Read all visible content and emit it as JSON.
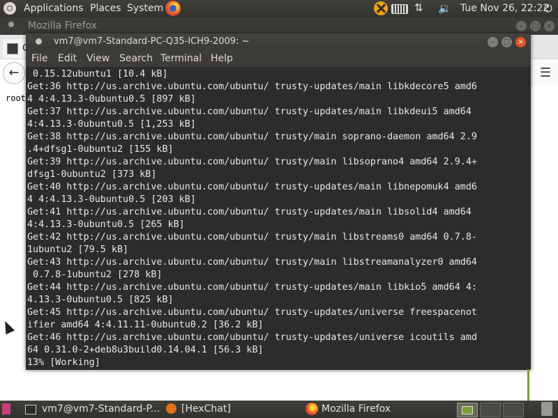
{
  "top_panel": {
    "menus": [
      "Applications",
      "Places",
      "System"
    ],
    "clock": "Tue Nov 26, 22:22",
    "icons": [
      "ubuntu-logo",
      "firefox-launcher-icon",
      "indicator-x-icon",
      "keyboard-icon",
      "network-icon",
      "volume-icon",
      "power-icon"
    ]
  },
  "firefox": {
    "window_title": "Mozilla Firefox",
    "tab_label": "C",
    "page_text": "root"
  },
  "terminal": {
    "window_title": "vm7@vm7-Standard-PC-Q35-ICH9-2009: ~",
    "menu": [
      "File",
      "Edit",
      "View",
      "Search",
      "Terminal",
      "Help"
    ],
    "lines": [
      " 0.15.12ubuntu1 [10.4 kB]",
      "Get:36 http://us.archive.ubuntu.com/ubuntu/ trusty-updates/main libkdecore5 amd6",
      "4 4:4.13.3-0ubuntu0.5 [897 kB]",
      "Get:37 http://us.archive.ubuntu.com/ubuntu/ trusty-updates/main libkdeui5 amd64",
      "4:4.13.3-0ubuntu0.5 [1,253 kB]",
      "Get:38 http://us.archive.ubuntu.com/ubuntu/ trusty/main soprano-daemon amd64 2.9",
      ".4+dfsg1-0ubuntu2 [155 kB]",
      "Get:39 http://us.archive.ubuntu.com/ubuntu/ trusty/main libsoprano4 amd64 2.9.4+",
      "dfsg1-0ubuntu2 [373 kB]",
      "Get:40 http://us.archive.ubuntu.com/ubuntu/ trusty-updates/main libnepomuk4 amd6",
      "4 4:4.13.3-0ubuntu0.5 [203 kB]",
      "Get:41 http://us.archive.ubuntu.com/ubuntu/ trusty-updates/main libsolid4 amd64",
      "4:4.13.3-0ubuntu0.5 [265 kB]",
      "Get:42 http://us.archive.ubuntu.com/ubuntu/ trusty/main libstreams0 amd64 0.7.8-",
      "1ubuntu2 [79.5 kB]",
      "Get:43 http://us.archive.ubuntu.com/ubuntu/ trusty/main libstreamanalyzer0 amd64",
      " 0.7.8-1ubuntu2 [278 kB]",
      "Get:44 http://us.archive.ubuntu.com/ubuntu/ trusty-updates/main libkio5 amd64 4:",
      "4.13.3-0ubuntu0.5 [825 kB]",
      "Get:45 http://us.archive.ubuntu.com/ubuntu/ trusty-updates/universe freespacenot",
      "ifier amd64 4:4.11.11-0ubuntu0.2 [36.2 kB]",
      "Get:46 http://us.archive.ubuntu.com/ubuntu/ trusty-updates/universe icoutils amd",
      "64 0.31.0-2+deb8u3build0.14.04.1 [56.3 kB]",
      "13% [Working]"
    ]
  },
  "taskbar": {
    "items": [
      "vm7@vm7-Standard-P...",
      "[HexChat]",
      "Mozilla Firefox"
    ]
  },
  "colors": {
    "panel_bg": "#3c3b37",
    "terminal_bg": "#2c2c2c",
    "terminal_fg": "#e8e8e8",
    "close_button": "#e0552a"
  }
}
